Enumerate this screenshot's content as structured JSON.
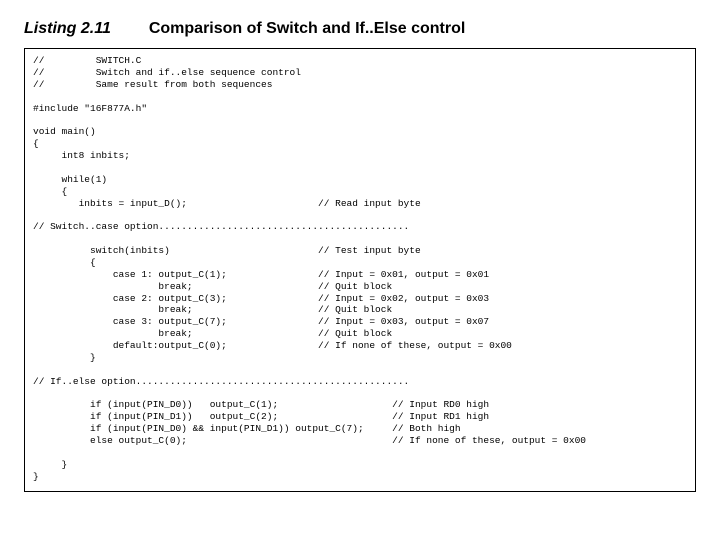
{
  "header": {
    "listing_label": "Listing 2.11",
    "title": "Comparison of Switch and If..Else control"
  },
  "code": "//         SWITCH.C\n//         Switch and if..else sequence control\n//         Same result from both sequences\n\n#include \"16F877A.h\"\n\nvoid main()\n{\n     int8 inbits;\n\n     while(1)\n     {\n        inbits = input_D();                       // Read input byte\n\n// Switch..case option............................................\n\n          switch(inbits)                          // Test input byte\n          {\n              case 1: output_C(1);                // Input = 0x01, output = 0x01\n                      break;                      // Quit block\n              case 2: output_C(3);                // Input = 0x02, output = 0x03\n                      break;                      // Quit block\n              case 3: output_C(7);                // Input = 0x03, output = 0x07\n                      break;                      // Quit block\n              default:output_C(0);                // If none of these, output = 0x00\n          }\n\n// If..else option................................................\n\n          if (input(PIN_D0))   output_C(1);                    // Input RD0 high\n          if (input(PIN_D1))   output_C(2);                    // Input RD1 high\n          if (input(PIN_D0) && input(PIN_D1)) output_C(7);     // Both high\n          else output_C(0);                                    // If none of these, output = 0x00\n\n     }\n}"
}
